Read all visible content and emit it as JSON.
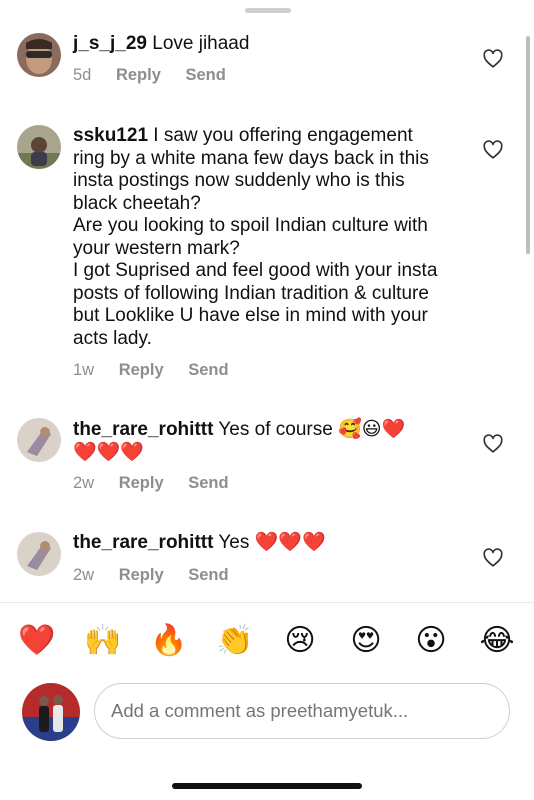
{
  "comments": [
    {
      "username": "j_s_j_29",
      "lines": [
        "Love jihaad"
      ],
      "time": "5d",
      "reply": "Reply",
      "send": "Send"
    },
    {
      "username": "ssku121",
      "lines": [
        "I saw you offering engagement",
        "ring by a white mana few days back in this",
        "insta postings now suddenly who is this",
        "black cheetah?",
        "Are you looking to spoil Indian culture with",
        "your western mark?",
        "I got Suprised and feel good with your insta",
        "posts of following Indian tradition & culture",
        "but Looklike U have else in mind with your",
        "acts lady."
      ],
      "time": "1w",
      "reply": "Reply",
      "send": "Send"
    },
    {
      "username": "the_rare_rohittt",
      "lines": [
        "Yes of course 🥰😃❤️",
        "❤️❤️❤️"
      ],
      "time": "2w",
      "reply": "Reply",
      "send": "Send"
    },
    {
      "username": "the_rare_rohittt",
      "lines": [
        "Yes ❤️❤️❤️"
      ],
      "time": "2w",
      "reply": "Reply",
      "send": "Send"
    }
  ],
  "reactions": [
    "❤️",
    "🙌",
    "🔥",
    "👏",
    "😢",
    "😍",
    "😮",
    "😂"
  ],
  "composer": {
    "placeholder": "Add a comment as preethamyetuk..."
  },
  "icons": {
    "like": "heart-outline-icon",
    "grabber": "drag-handle-icon"
  }
}
